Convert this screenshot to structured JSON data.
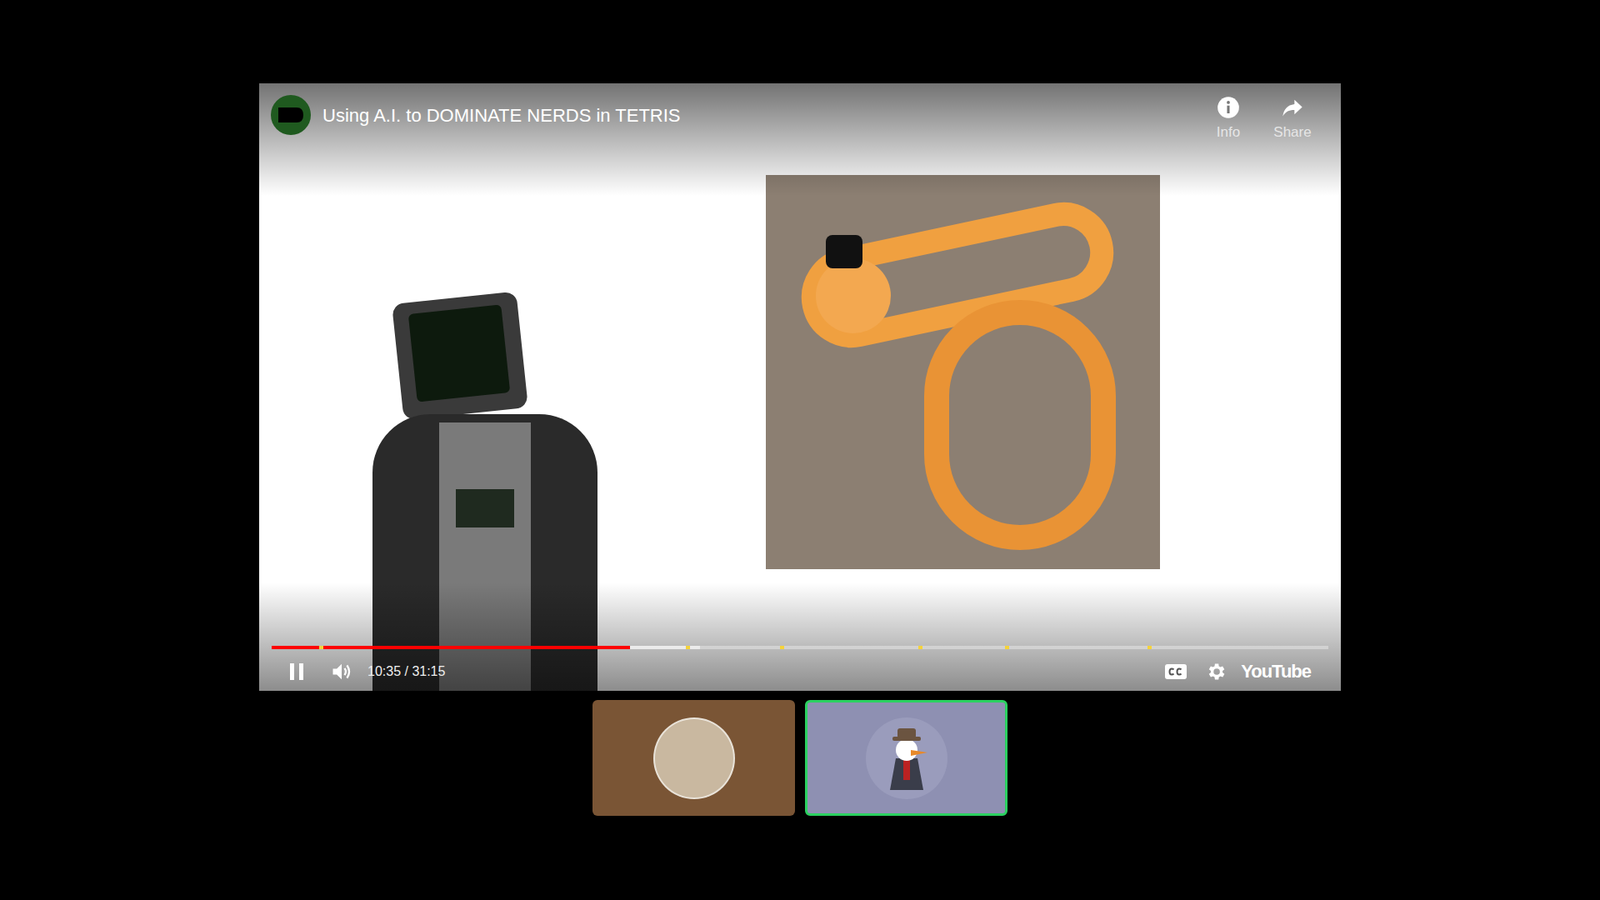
{
  "player": {
    "title": "Using A.I. to DOMINATE NERDS in TETRIS",
    "info_label": "Info",
    "share_label": "Share",
    "playing": true,
    "time": "10:35 / 31:15",
    "brand": "YouTube",
    "progress": {
      "level": 0.339,
      "buffered": 0.405,
      "markers": [
        0.045,
        0.392,
        0.481,
        0.612,
        0.694,
        0.829
      ]
    }
  },
  "participants": [
    {
      "selected": false,
      "color": "#7a5535"
    },
    {
      "selected": true,
      "color": "#8e90b2"
    }
  ]
}
